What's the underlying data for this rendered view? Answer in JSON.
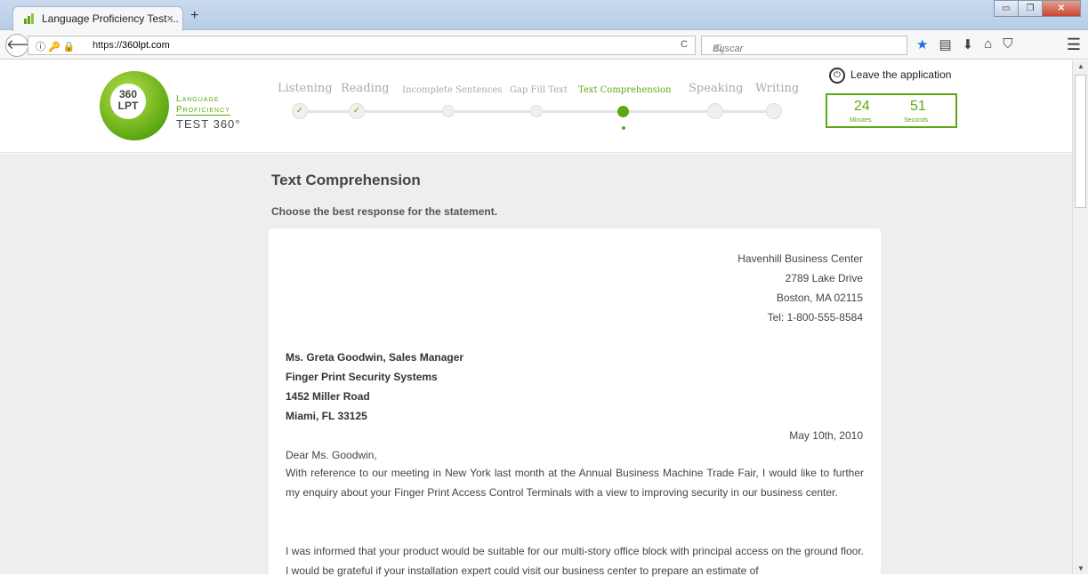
{
  "browser": {
    "tab_title": "Language Proficiency Test ...",
    "tab_close": "×",
    "new_tab": "+",
    "url_scheme": "https://",
    "url_host": "360lpt.com",
    "search_placeholder": "Buscar",
    "info_icons": "ⓘ 🔑 🔒",
    "reload": "C"
  },
  "header": {
    "logo_badge_1": "360",
    "logo_badge_2": "LPT",
    "logo_line1": "Language",
    "logo_line2": "Proficiency",
    "logo_line3": "TEST 360°",
    "leave_label": "Leave the application",
    "timer": {
      "minutes": "24",
      "minutes_label": "Minutes",
      "seconds": "51",
      "seconds_label": "Seconds"
    },
    "steps": [
      {
        "label": "Listening",
        "status": "done"
      },
      {
        "label": "Reading",
        "status": "done"
      },
      {
        "label": "Incomplete Sentences",
        "status": "pending"
      },
      {
        "label": "Gap Fill Text",
        "status": "pending"
      },
      {
        "label": "Text Comprehension",
        "status": "active"
      },
      {
        "label": "Speaking",
        "status": "pending"
      },
      {
        "label": "Writing",
        "status": "pending"
      }
    ],
    "check_glyph": "✓"
  },
  "main": {
    "title": "Text Comprehension",
    "instruction": "Choose the best response for the statement.",
    "letter": {
      "sender": [
        "Havenhill Business Center",
        "2789 Lake Drive",
        "Boston, MA 02115",
        "Tel: 1-800-555-8584"
      ],
      "recipient": [
        "Ms. Greta Goodwin, Sales Manager",
        "Finger Print Security Systems",
        "1452 Miller Road",
        "Miami, FL 33125"
      ],
      "date": "May 10th, 2010",
      "salutation": "Dear Ms. Goodwin,",
      "para1": "With reference to our meeting in New York last month at the Annual Business Machine Trade Fair, I would like to further my enquiry about your Finger Print Access Control Terminals with a view to improving security in our business center.",
      "para2": "I was informed that your product would be suitable for our multi-story office block with principal access on the ground floor. I would be grateful if your installation expert could visit our business center to prepare an estimate of"
    }
  },
  "colors": {
    "accent": "#5da812",
    "text": "#444444",
    "background": "#eeeeee"
  }
}
